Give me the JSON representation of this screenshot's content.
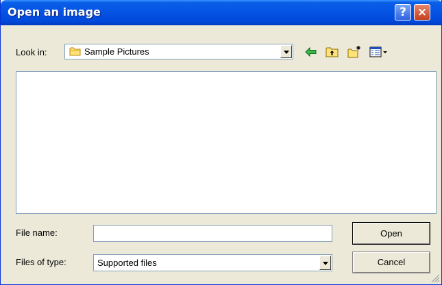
{
  "window": {
    "title": "Open an image",
    "help_symbol": "?",
    "close_symbol": "×",
    "titlebar_color": "#0654E4",
    "icons": [
      "help-icon",
      "close-icon"
    ]
  },
  "look_in": {
    "label": "Look in:",
    "value": "Sample Pictures",
    "value_icon": "folder-icon"
  },
  "toolbar": {
    "icons": [
      "back-arrow-icon",
      "up-folder-icon",
      "new-folder-icon",
      "view-menu-icon"
    ]
  },
  "file_name": {
    "label": "File name:",
    "value": ""
  },
  "files_of_type": {
    "label": "Files of type:",
    "value": "Supported files"
  },
  "buttons": {
    "open": "Open",
    "cancel": "Cancel"
  }
}
